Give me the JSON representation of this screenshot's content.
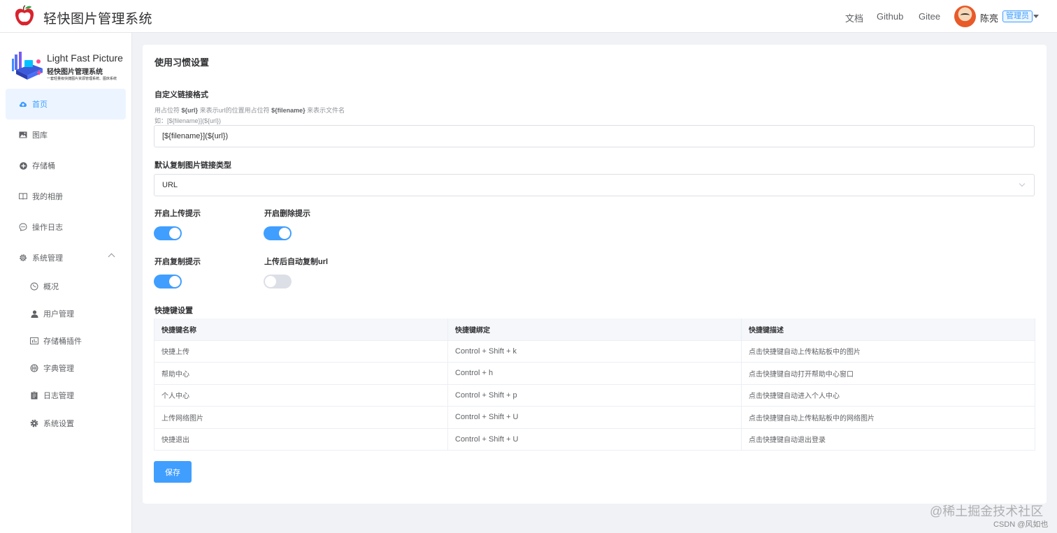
{
  "header": {
    "app_title": "轻快图片管理系统",
    "nav": [
      "文档",
      "Github",
      "Gitee"
    ],
    "user_name": "陈亮",
    "role_badge": "管理员"
  },
  "sidebar": {
    "brand_en": "Light Fast Picture",
    "brand_cn": "轻快图片管理系统",
    "brand_sub": "一套轻量级快捷图片资源管理系统、图床系统",
    "items": [
      {
        "label": "首页",
        "icon": "cloud-upload-icon",
        "active": true
      },
      {
        "label": "图库",
        "icon": "picture-icon"
      },
      {
        "label": "存储桶",
        "icon": "plus-circle-icon"
      },
      {
        "label": "我的相册",
        "icon": "book-icon"
      },
      {
        "label": "操作日志",
        "icon": "chat-dots-icon"
      },
      {
        "label": "系统管理",
        "icon": "gear-icon",
        "expanded": true
      }
    ],
    "sub_items": [
      {
        "label": "概况",
        "icon": "compass-icon"
      },
      {
        "label": "用户管理",
        "icon": "user-icon"
      },
      {
        "label": "存储桶插件",
        "icon": "chart-icon"
      },
      {
        "label": "字典管理",
        "icon": "basketball-icon"
      },
      {
        "label": "日志管理",
        "icon": "clipboard-icon"
      },
      {
        "label": "系统设置",
        "icon": "settings-icon"
      }
    ]
  },
  "settings": {
    "title": "使用习惯设置",
    "link_format": {
      "label": "自定义链接格式",
      "hint_prefix": "用占位符",
      "hint_url": "${url}",
      "hint_mid": "来表示url的位置用占位符",
      "hint_filename": "${filename}",
      "hint_suffix": "来表示文件名",
      "example": "如：[${filename}](${url})",
      "value": "[${filename}](${url})"
    },
    "copy_type": {
      "label": "默认复制图片链接类型",
      "value": "URL"
    },
    "toggles": [
      {
        "label": "开启上传提示",
        "on": true
      },
      {
        "label": "开启删除提示",
        "on": true
      },
      {
        "label": "开启复制提示",
        "on": true
      },
      {
        "label": "上传后自动复制url",
        "on": false
      }
    ],
    "shortcuts": {
      "label": "快捷键设置",
      "columns": [
        "快捷键名称",
        "快捷键绑定",
        "快捷键描述"
      ],
      "rows": [
        [
          "快捷上传",
          "Control + Shift + k",
          "点击快捷键自动上传粘贴板中的图片"
        ],
        [
          "帮助中心",
          "Control + h",
          "点击快捷键自动打开帮助中心窗口"
        ],
        [
          "个人中心",
          "Control + Shift + p",
          "点击快捷键自动进入个人中心"
        ],
        [
          "上传网络图片",
          "Control + Shift + U",
          "点击快捷键自动上传粘贴板中的网络图片"
        ],
        [
          "快捷退出",
          "Control + Shift + U",
          "点击快捷键自动退出登录"
        ]
      ]
    },
    "save_label": "保存"
  },
  "watermark": {
    "line1": "@稀土掘金技术社区",
    "line2": "CSDN @风如也"
  },
  "colors": {
    "primary": "#409eff",
    "active_bg": "#ecf5ff",
    "page_bg": "#f0f2f5"
  }
}
